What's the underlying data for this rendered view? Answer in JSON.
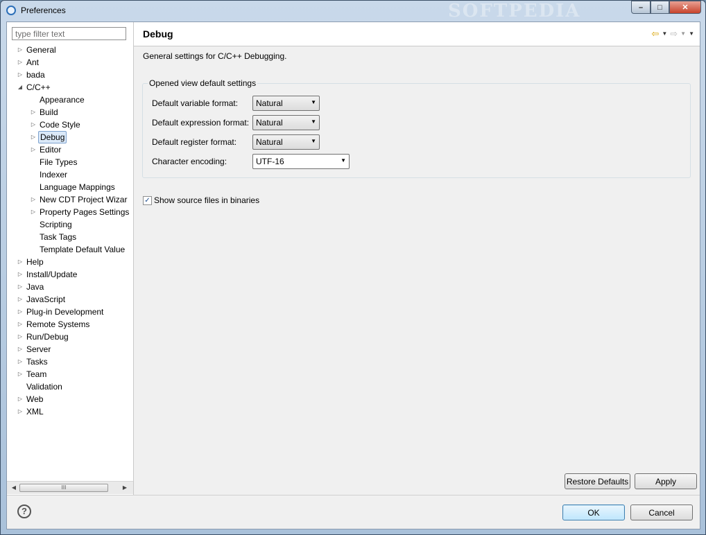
{
  "window": {
    "title": "Preferences",
    "watermark": "SOFTPEDIA",
    "controls": {
      "minimize": "–",
      "maximize": "□",
      "close": "✕"
    }
  },
  "filter": {
    "placeholder": "type filter text"
  },
  "tree": [
    {
      "label": "General",
      "level": 0,
      "arrow": "▷"
    },
    {
      "label": "Ant",
      "level": 0,
      "arrow": "▷"
    },
    {
      "label": "bada",
      "level": 0,
      "arrow": "▷"
    },
    {
      "label": "C/C++",
      "level": 0,
      "arrow": "◢"
    },
    {
      "label": "Appearance",
      "level": 1,
      "arrow": ""
    },
    {
      "label": "Build",
      "level": 1,
      "arrow": "▷"
    },
    {
      "label": "Code Style",
      "level": 1,
      "arrow": "▷"
    },
    {
      "label": "Debug",
      "level": 1,
      "arrow": "▷",
      "selected": true
    },
    {
      "label": "Editor",
      "level": 1,
      "arrow": "▷"
    },
    {
      "label": "File Types",
      "level": 1,
      "arrow": ""
    },
    {
      "label": "Indexer",
      "level": 1,
      "arrow": ""
    },
    {
      "label": "Language Mappings",
      "level": 1,
      "arrow": ""
    },
    {
      "label": "New CDT Project Wizar",
      "level": 1,
      "arrow": "▷"
    },
    {
      "label": "Property Pages Settings",
      "level": 1,
      "arrow": "▷"
    },
    {
      "label": "Scripting",
      "level": 1,
      "arrow": ""
    },
    {
      "label": "Task Tags",
      "level": 1,
      "arrow": ""
    },
    {
      "label": "Template Default Value",
      "level": 1,
      "arrow": ""
    },
    {
      "label": "Help",
      "level": 0,
      "arrow": "▷"
    },
    {
      "label": "Install/Update",
      "level": 0,
      "arrow": "▷"
    },
    {
      "label": "Java",
      "level": 0,
      "arrow": "▷"
    },
    {
      "label": "JavaScript",
      "level": 0,
      "arrow": "▷"
    },
    {
      "label": "Plug-in Development",
      "level": 0,
      "arrow": "▷"
    },
    {
      "label": "Remote Systems",
      "level": 0,
      "arrow": "▷"
    },
    {
      "label": "Run/Debug",
      "level": 0,
      "arrow": "▷"
    },
    {
      "label": "Server",
      "level": 0,
      "arrow": "▷"
    },
    {
      "label": "Tasks",
      "level": 0,
      "arrow": "▷"
    },
    {
      "label": "Team",
      "level": 0,
      "arrow": "▷"
    },
    {
      "label": "Validation",
      "level": 0,
      "arrow": ""
    },
    {
      "label": "Web",
      "level": 0,
      "arrow": "▷"
    },
    {
      "label": "XML",
      "level": 0,
      "arrow": "▷"
    }
  ],
  "scrollbar": {
    "left_arrow": "◀",
    "right_arrow": "▶",
    "grip": "III"
  },
  "page": {
    "title": "Debug",
    "nav": {
      "back": "⇦",
      "forward": "⇨",
      "dropdown": "▼"
    },
    "description": "General settings for C/C++ Debugging.",
    "group_title": "Opened view default settings",
    "settings": [
      {
        "label": "Default variable format:",
        "value": "Natural"
      },
      {
        "label": "Default expression format:",
        "value": "Natural"
      },
      {
        "label": "Default register format:",
        "value": "Natural"
      },
      {
        "label": "Character encoding:",
        "value": "UTF-16"
      }
    ],
    "checkbox": {
      "label": "Show source files in binaries",
      "checked": true,
      "mark": "✓"
    },
    "restore_defaults": "Restore Defaults",
    "apply": "Apply"
  },
  "footer": {
    "help": "?",
    "ok": "OK",
    "cancel": "Cancel"
  }
}
